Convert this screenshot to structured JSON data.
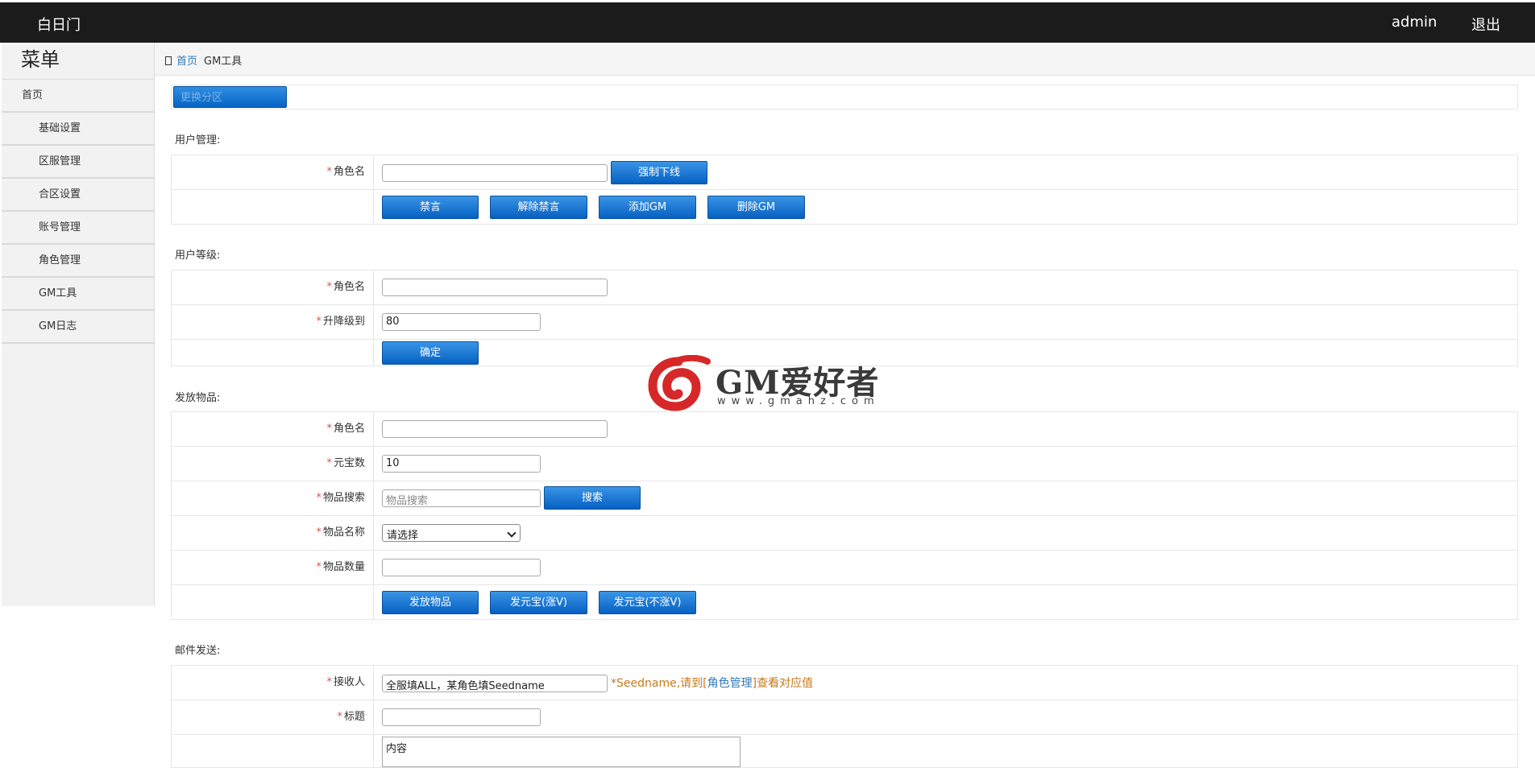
{
  "topbar": {
    "brand": "白日门",
    "user": "admin",
    "logout": "退出"
  },
  "sidebar": {
    "title": "菜单",
    "items": [
      {
        "label": "首页"
      },
      {
        "label": "基础设置"
      },
      {
        "label": "区服管理"
      },
      {
        "label": "合区设置"
      },
      {
        "label": "账号管理"
      },
      {
        "label": "角色管理"
      },
      {
        "label": "GM工具"
      },
      {
        "label": "GM日志"
      }
    ]
  },
  "breadcrumb": {
    "home": "首页",
    "current": "GM工具"
  },
  "zone": {
    "button": "更换分区"
  },
  "user_mgmt": {
    "title": "用户管理:",
    "role_label": "角色名",
    "role_value": "",
    "kick_button": "强制下线",
    "mute_button": "禁言",
    "unmute_button": "解除禁言",
    "add_gm_button": "添加GM",
    "remove_gm_button": "删除GM"
  },
  "user_level": {
    "title": "用户等级:",
    "role_label": "角色名",
    "role_value": "",
    "level_label": "升降级到",
    "level_value": "80",
    "confirm_button": "确定"
  },
  "items_give": {
    "title": "发放物品:",
    "role_label": "角色名",
    "role_value": "",
    "ingot_label": "元宝数",
    "ingot_value": "10",
    "search_label": "物品搜索",
    "search_placeholder": "物品搜索",
    "search_button": "搜索",
    "name_label": "物品名称",
    "name_selected": "请选择",
    "qty_label": "物品数量",
    "qty_value": "",
    "give_button": "发放物品",
    "ingot_v_button": "发元宝(涨V)",
    "ingot_nov_button": "发元宝(不涨V)"
  },
  "mail": {
    "title": "邮件发送:",
    "recipient_label": "接收人",
    "recipient_value": "全服填ALL，某角色填Seedname",
    "hint_prefix": "*Seedname,请到[",
    "hint_link": "角色管理",
    "hint_suffix": "]查看对应值",
    "subject_label": "标题",
    "subject_value": "",
    "content_value": "内容"
  },
  "watermark": {
    "text": "GM爱好者",
    "url": "www.gmahz.com"
  },
  "colors": {
    "topbar": "#1b1b1b",
    "button": "#0663c4",
    "required": "#d9534f",
    "hint": "#c77a17",
    "link": "#337ab7"
  }
}
